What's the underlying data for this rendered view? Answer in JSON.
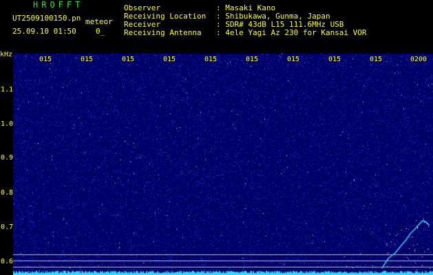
{
  "header": {
    "app_name": "HROFFT",
    "filename": "UT2509100150.pn",
    "mode": "meteor",
    "datetime": "25.09.10 01:50",
    "status": "0_"
  },
  "info": {
    "labels": [
      "Observer",
      "Receiving Location",
      "Receiver",
      "Receiving Antenna"
    ],
    "values": [
      ": Masaki Kano",
      ": Shibukawa, Gunma, Japan",
      ": SDR# 43dB L15 111.6MHz USB",
      ": 4ele Yagi Az 230 for Kansai VOR"
    ]
  },
  "axis": {
    "unit": "kHz",
    "y_ticks": [
      "1.1",
      "1.0",
      "0.9",
      "0.8",
      "0.7",
      "0.6"
    ],
    "time_ticks": [
      "015",
      "015",
      "015",
      "015",
      "015",
      "015",
      "015",
      "015",
      "015",
      "0200"
    ]
  },
  "colors": {
    "background": "#000000",
    "plot": "#000066",
    "axis_text": "#ffff33",
    "title": "#33e633",
    "trace": "#33d6ff"
  }
}
